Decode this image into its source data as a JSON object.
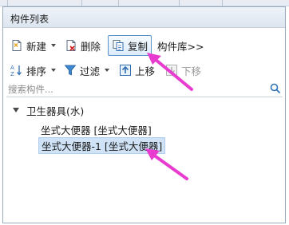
{
  "panel": {
    "title": "构件列表"
  },
  "toolbar1": {
    "new_label": "新建",
    "delete_label": "删除",
    "copy_label": "复制",
    "library_label": "构件库>>"
  },
  "toolbar2": {
    "sort_label": "排序",
    "filter_label": "过滤",
    "move_up_label": "上移",
    "move_down_label": "下移"
  },
  "search": {
    "placeholder": "搜索构件..."
  },
  "tree": {
    "root_label": "卫生器具(水)",
    "items": [
      {
        "label": "坐式大便器 [坐式大便器]",
        "selected": false
      },
      {
        "label": "坐式大便器-1 [坐式大便器]",
        "selected": true
      }
    ]
  },
  "colors": {
    "selection": "#cfe2f6",
    "annotation_arrow": "#e83bd0",
    "search_icon": "#2f73b8"
  }
}
